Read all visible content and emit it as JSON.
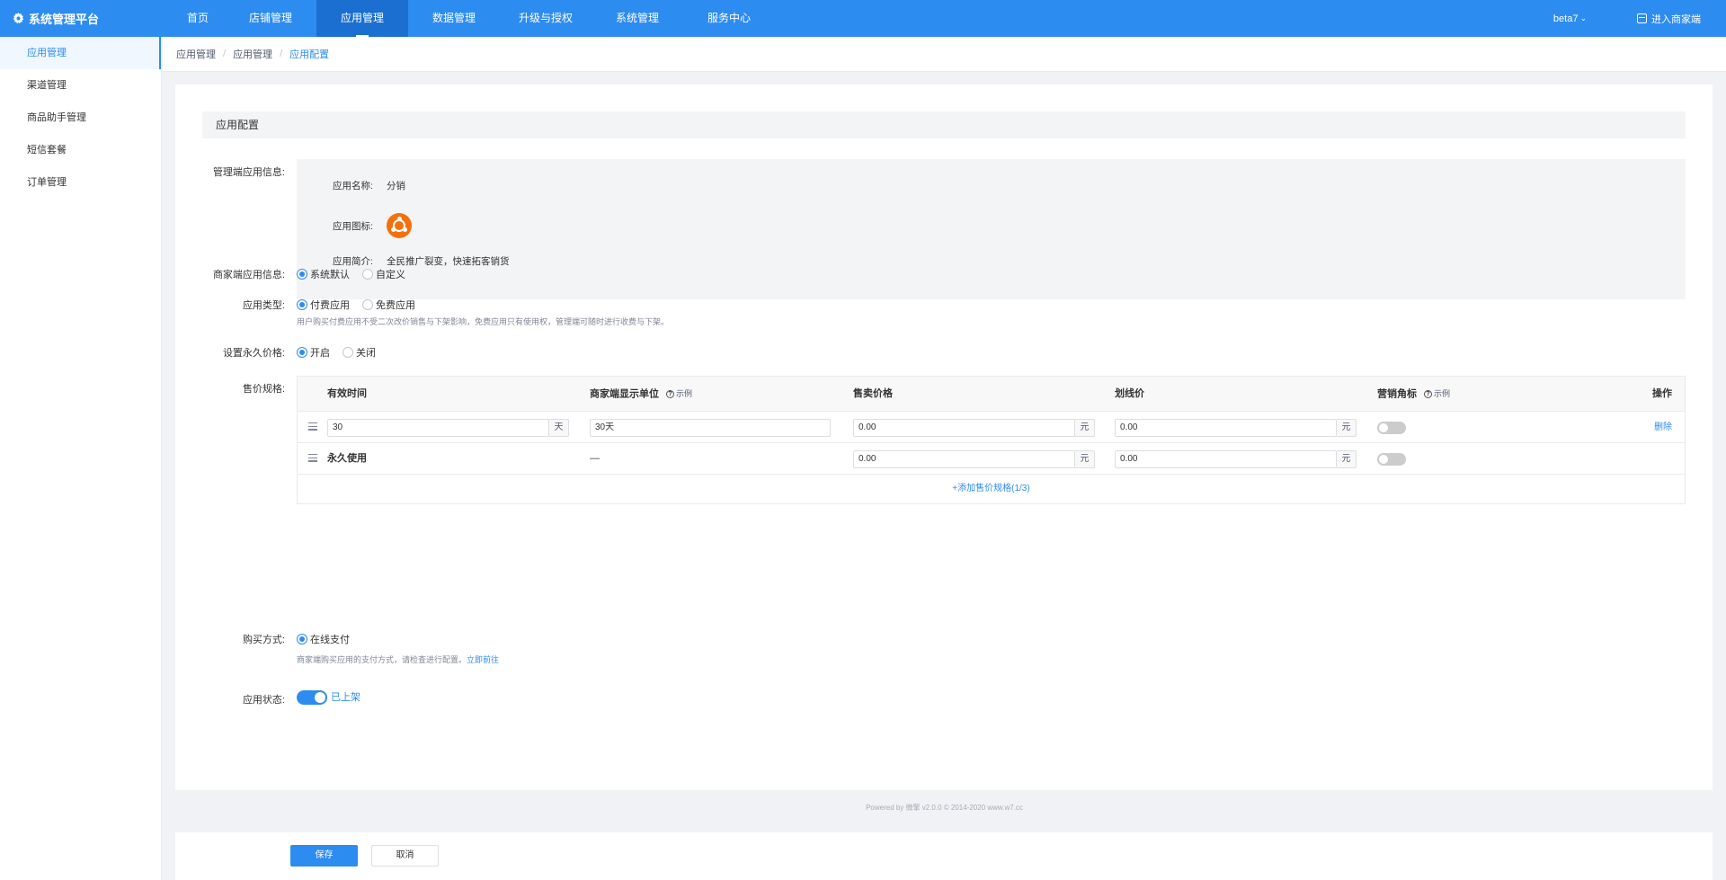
{
  "app": {
    "title": "系统管理平台"
  },
  "nav": {
    "items": [
      {
        "label": "首页"
      },
      {
        "label": "店铺管理"
      },
      {
        "label": "应用管理"
      },
      {
        "label": "数据管理"
      },
      {
        "label": "升级与授权"
      },
      {
        "label": "系统管理"
      },
      {
        "label": "服务中心"
      }
    ],
    "active_index": 2
  },
  "header": {
    "user": "beta7",
    "enter_label": "进入商家端"
  },
  "sidebar": {
    "items": [
      {
        "label": "应用管理"
      },
      {
        "label": "渠道管理"
      },
      {
        "label": "商品助手管理"
      },
      {
        "label": "短信套餐"
      },
      {
        "label": "订单管理"
      }
    ]
  },
  "breadcrumb": [
    "应用管理",
    "应用管理",
    "应用配置"
  ],
  "form": {
    "section_title": "应用配置",
    "admin_info_label": "管理端应用信息:",
    "app_name_key": "应用名称:",
    "app_name": "分销",
    "app_icon_key": "应用图标:",
    "app_desc_key": "应用简介:",
    "app_desc": "全民推广裂变，快速拓客销货",
    "merchant_info_label": "商家端应用信息:",
    "merchant_info_options": [
      "系统默认",
      "自定义"
    ],
    "app_type_label": "应用类型:",
    "app_type_options": [
      "付费应用",
      "免费应用"
    ],
    "app_type_hint": "用户购买付费应用不受二次改价销售与下架影响，免费应用只有使用权，管理端可随时进行收费与下架。",
    "perm_price_label": "设置永久价格:",
    "perm_price_options": [
      "开启",
      "关闭"
    ],
    "pricing_label": "售价规格:",
    "table": {
      "headers": [
        "有效时间",
        "商家端显示单位",
        "售卖价格",
        "划线价",
        "营销角标",
        "操作"
      ],
      "example": "示例",
      "rows": [
        {
          "duration": "30",
          "duration_unit": "天",
          "display_unit": "30天",
          "price": "0.00",
          "price_unit": "元",
          "orig_price": "0.00",
          "orig_unit": "元",
          "action": "删除"
        },
        {
          "duration": "永久使用",
          "display_unit": "—",
          "price": "0.00",
          "price_unit": "元",
          "orig_price": "0.00",
          "orig_unit": "元"
        }
      ],
      "add_label": "+添加售价规格(1/3)"
    },
    "purchase_label": "购买方式:",
    "purchase_option": "在线支付",
    "purchase_hint": "商家端购买应用的支付方式，请检查进行配置。",
    "purchase_link": "立即前往",
    "status_label": "应用状态:",
    "status_text": "已上架",
    "save_label": "保存",
    "cancel_label": "取消"
  },
  "footer": {
    "text": "Powered by 微擎 v2.0.0 © 2014-2020 www.w7.cc"
  },
  "colors": {
    "primary": "#2d8cf0",
    "app_icon": "#f5700b"
  }
}
